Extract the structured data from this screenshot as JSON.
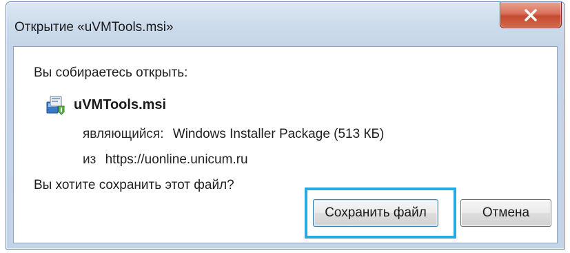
{
  "window": {
    "title": "Открытие «uVMTools.msi»"
  },
  "dialog": {
    "prompt_open": "Вы собираетесь открыть:",
    "file_name": "uVMTools.msi",
    "type_label": "являющийся:",
    "type_value": "Windows Installer Package (513 КБ)",
    "from_label": "из",
    "from_value": "https://uonline.unicum.ru",
    "prompt_save": "Вы хотите сохранить этот файл?"
  },
  "buttons": {
    "save_label": "Сохранить файл",
    "cancel_label": "Отмена"
  },
  "icons": {
    "close": "close-icon",
    "file": "msi-installer-icon"
  },
  "colors": {
    "highlight": "#27aae1",
    "close_button": "#c44a30",
    "title_bar": "#cddcec"
  }
}
